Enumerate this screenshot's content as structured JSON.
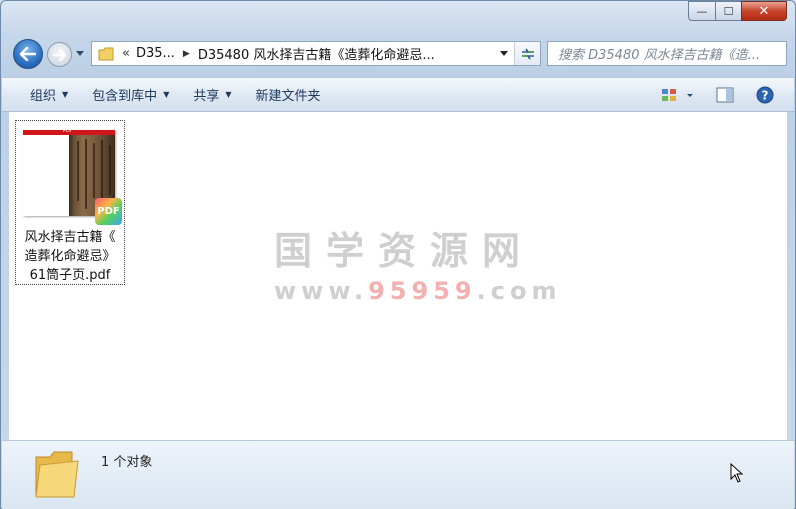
{
  "window": {
    "caption": {
      "minimize": "—",
      "maximize": "☐",
      "close": "✕"
    }
  },
  "nav": {
    "back": "back",
    "forward": "forward",
    "address": {
      "overflow": "«",
      "crumbs": [
        "D35...",
        "D35480 风水择吉古籍《造葬化命避忌..."
      ]
    },
    "search_placeholder": "搜索 D35480 风水择吉古籍《造..."
  },
  "toolbar": {
    "items": [
      {
        "label": "组织",
        "has_arrow": true
      },
      {
        "label": "包含到库中",
        "has_arrow": true
      },
      {
        "label": "共享",
        "has_arrow": true
      },
      {
        "label": "新建文件夹",
        "has_arrow": false
      }
    ]
  },
  "files": [
    {
      "name_line1": "风水择吉古籍《",
      "name_line2": "造葬化命避忌》",
      "name_line3": "61筒子页.pdf",
      "thumb_label": "PDF",
      "badge": "PDF"
    }
  ],
  "watermark": {
    "title": "国学资源网",
    "url_pre": "www.",
    "url_num": "95959",
    "url_post": ".com"
  },
  "status": {
    "text": "1 个对象"
  },
  "colors": {
    "accent": "#1e395b",
    "close_red": "#c7452d"
  }
}
